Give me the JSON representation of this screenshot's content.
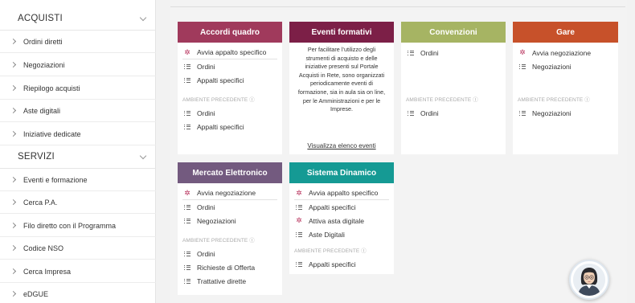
{
  "sidebar": {
    "sections": [
      {
        "title": "ACQUISTI",
        "items": [
          "Ordini diretti",
          "Negoziazioni",
          "Riepilogo acquisti",
          "Aste digitali",
          "Iniziative dedicate"
        ]
      },
      {
        "title": "SERVIZI",
        "items": [
          "Eventi e formazione",
          "Cerca P.A.",
          "Filo diretto con il Programma",
          "Codice NSO",
          "Cerca Impresa",
          "eDGUE"
        ]
      }
    ]
  },
  "colors": {
    "accordi": "#a03a5c",
    "eventi": "#7c1f47",
    "convenzioni": "#a6b463",
    "gare": "#c7512a",
    "mercato": "#735a7f",
    "sistema": "#159a94",
    "spark": "#b8325c"
  },
  "cards": {
    "accordi": {
      "title": "Accordi quadro",
      "items": [
        "Avvia appalto specifico",
        "Ordini",
        "Appalti specifici"
      ],
      "prev_label": "AMBIENTE PRECEDENTE ⓘ",
      "prev_items": [
        "Ordini",
        "Appalti specifici"
      ]
    },
    "eventi": {
      "title": "Eventi formativi",
      "text": "Per facilitare l’utilizzo degli strumenti di acquisto e delle iniziative presenti sul Portale Acquisti in Rete, sono organizzati periodicamente eventi di formazione, sia in aula sia on line, per le Amministrazioni e per le Imprese.",
      "link": "Visualizza elenco eventi"
    },
    "convenzioni": {
      "title": "Convenzioni",
      "items": [
        "Ordini"
      ],
      "prev_label": "AMBIENTE PRECEDENTE ⓘ",
      "prev_items": [
        "Ordini"
      ]
    },
    "gare": {
      "title": "Gare",
      "items": [
        "Avvia negoziazione",
        "Negoziazioni"
      ],
      "prev_label": "AMBIENTE PRECEDENTE ⓘ",
      "prev_items": [
        "Negoziazioni"
      ]
    },
    "mercato": {
      "title": "Mercato Elettronico",
      "items": [
        "Avvia negoziazione",
        "Ordini",
        "Negoziazioni"
      ],
      "prev_label": "AMBIENTE PRECEDENTE ⓘ",
      "prev_items": [
        "Ordini",
        "Richieste di Offerta",
        "Trattative dirette"
      ]
    },
    "sistema": {
      "title": "Sistema Dinamico",
      "items": [
        "Avvia appalto specifico",
        "Appalti specifici",
        "Attiva asta digitale",
        "Aste Digitali"
      ],
      "prev_label": "AMBIENTE PRECEDENTE ⓘ",
      "prev_items": [
        "Appalti specifici"
      ]
    }
  }
}
